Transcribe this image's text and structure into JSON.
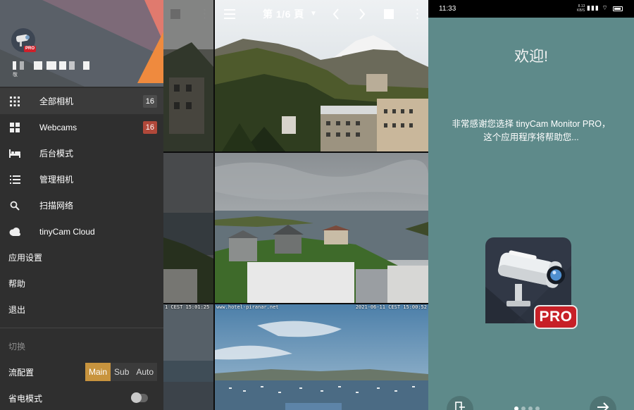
{
  "grid": {
    "page_label": "第 1/6 頁",
    "osd_site": "www.hotel-piranar.net",
    "osd_time_left": "1 CEST 15:01:25",
    "osd_time_right": "2021-06-11 CEST 15:00:52",
    "icons": {
      "menu": "hamburger-icon",
      "dropdown": "caret-down-icon",
      "prev": "chevron-left-icon",
      "next": "chevron-right-icon",
      "select": "square-icon",
      "overflow": "more-vert-icon"
    }
  },
  "drawer": {
    "header": {
      "pro_tag": "PRO",
      "subtitle": "敬"
    },
    "items": [
      {
        "label": "全部相机",
        "icon": "grid-icon",
        "count": "16",
        "badge_color": "#4d4d4d"
      },
      {
        "label": "Webcams",
        "icon": "tiles-icon",
        "count": "16",
        "badge_color": "#b0483a"
      },
      {
        "label": "后台模式",
        "icon": "bed-icon"
      },
      {
        "label": "管理相机",
        "icon": "list-icon"
      },
      {
        "label": "扫描网络",
        "icon": "search-icon"
      },
      {
        "label": "tinyCam Cloud",
        "icon": "cloud-icon"
      }
    ],
    "plain_items": [
      {
        "label": "应用设置"
      },
      {
        "label": "帮助"
      },
      {
        "label": "退出"
      }
    ],
    "section": "切换",
    "stream_profile": {
      "label": "流配置",
      "options": [
        "Main",
        "Sub",
        "Auto"
      ],
      "selected": "Main"
    },
    "power_save": {
      "label": "省电模式",
      "on": false
    },
    "accent": "#c8943e"
  },
  "welcome": {
    "status": {
      "time": "11:33",
      "net_speed": "8.13",
      "net_unit": "KB/S"
    },
    "title": "欢迎!",
    "body": "非常感谢您选择 tinyCam Monitor PRO，这个应用程序将帮助您...",
    "pro_badge": "PRO",
    "background": "#5e8a8a",
    "next_icon": "arrow-right-icon",
    "skip_icon": "exit-icon"
  }
}
